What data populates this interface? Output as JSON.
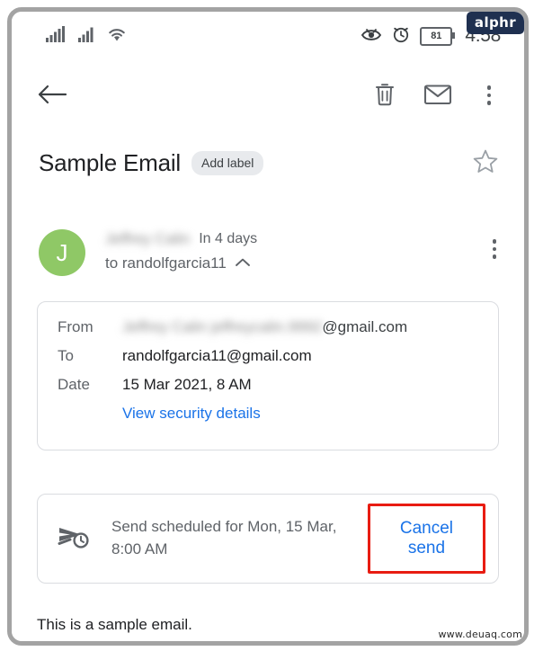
{
  "watermarks": {
    "brand_badge": "alphr",
    "site": "www.deuaq.com"
  },
  "status_bar": {
    "icons": [
      "signal-bars-icon",
      "signal-bars-icon",
      "wifi-icon",
      "eye-icon",
      "alarm-clock-icon"
    ],
    "battery_level": "81",
    "time": "4:58"
  },
  "toolbar": {
    "back_label": "back-arrow",
    "actions": [
      "delete-icon",
      "mark-unread-icon",
      "more-options-icon"
    ]
  },
  "subject": {
    "title": "Sample Email",
    "add_label_chip": "Add label",
    "starred": false
  },
  "sender": {
    "avatar_initial": "J",
    "avatar_color": "#8fc866",
    "name_redacted": "Jeffrey Calin",
    "time": "In 4 days",
    "recipient": "to randolfgarcia11",
    "expand_state": "expanded"
  },
  "details": {
    "from_label": "From",
    "from_redacted": "Jeffrey Calin  jeffreycalin.9992",
    "from_domain": "@gmail.com",
    "to_label": "To",
    "to_value": "randolfgarcia11@gmail.com",
    "date_label": "Date",
    "date_value": "15 Mar 2021, 8 AM",
    "security_link": "View security details"
  },
  "scheduled": {
    "icon": "scheduled-send-icon",
    "text": "Send scheduled for Mon, 15 Mar, 8:00 AM",
    "cancel_label": "Cancel send",
    "highlight_color": "#e81c12",
    "link_color": "#1a73e8"
  },
  "body": {
    "text": "This is a sample email."
  }
}
